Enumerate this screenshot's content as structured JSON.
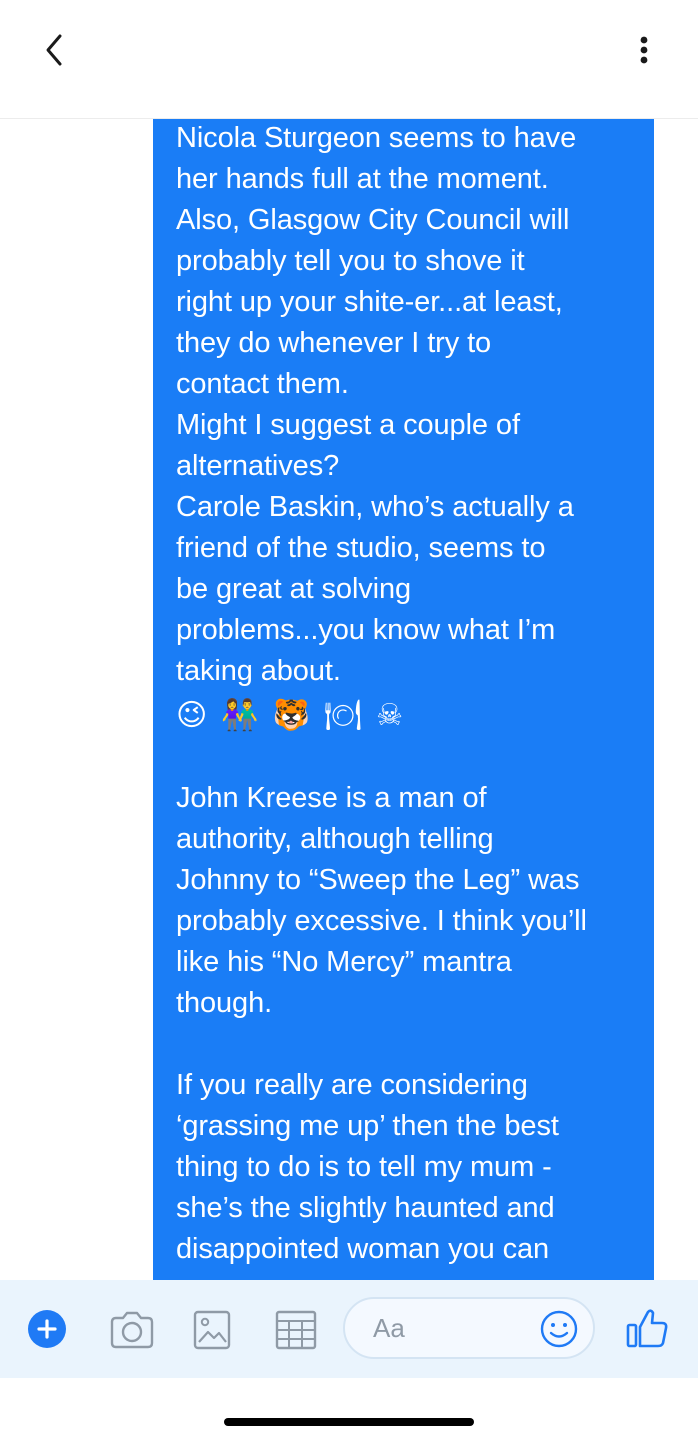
{
  "header": {
    "back_icon": "chevron-left-icon",
    "more_icon": "vertical-ellipsis-icon"
  },
  "message": {
    "lines_part1": [
      "Nicola Sturgeon seems to have",
      "her hands full at the moment.",
      "Also, Glasgow City Council will",
      "probably tell you to shove it",
      "right up your shite-er...at least,",
      "they do whenever I try to",
      "contact them.",
      "Might I suggest a couple of",
      "alternatives?",
      "Carole Baskin, who’s actually a",
      "friend of the studio, seems to",
      "be great at solving",
      "problems...you know what I’m",
      "taking about."
    ],
    "emojis": [
      "😉",
      "👫",
      "🐯",
      "🍽",
      "☠"
    ],
    "lines_part2": [
      "John Kreese is a man of",
      "authority, although telling",
      "Johnny to “Sweep the Leg” was",
      "probably excessive. I think you’ll",
      "like his “No Mercy” mantra",
      "though."
    ],
    "lines_part3": [
      "If you really are considering",
      "‘grassing me up’ then the best",
      "thing to do is to tell my mum -",
      "she’s the slightly haunted and",
      "disappointed woman you can"
    ],
    "bubble_color": "#1a7df6"
  },
  "composer": {
    "placeholder": "Aa",
    "icons": [
      "plus-icon",
      "camera-icon",
      "gallery-icon",
      "sticker-grid-icon",
      "emoji-icon",
      "thumbs-up-icon"
    ],
    "accent": "#1f7af5"
  }
}
